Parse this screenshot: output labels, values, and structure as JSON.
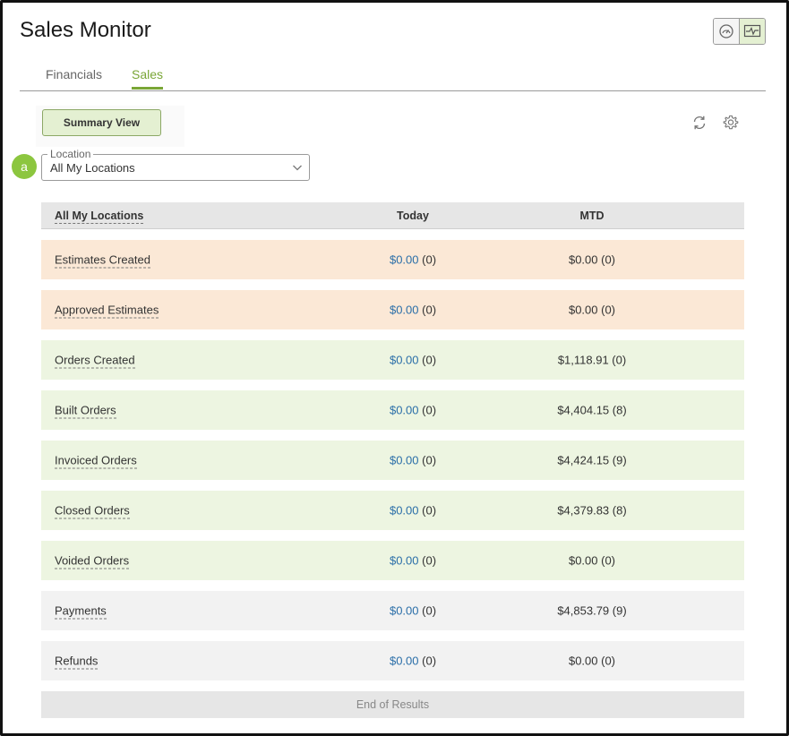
{
  "header": {
    "title": "Sales Monitor",
    "view_toggle": [
      {
        "icon": "gauge-icon",
        "active": false
      },
      {
        "icon": "activity-monitor-icon",
        "active": true
      }
    ]
  },
  "tabs": [
    {
      "label": "Financials",
      "active": false
    },
    {
      "label": "Sales",
      "active": true
    }
  ],
  "toolbar": {
    "summary_view_label": "Summary View",
    "refresh_icon": "refresh-icon",
    "settings_icon": "gear-icon"
  },
  "step_badge": "a",
  "location": {
    "legend": "Location",
    "value": "All My Locations"
  },
  "table": {
    "headers": [
      "All My Locations",
      "Today",
      "MTD"
    ],
    "rows": [
      {
        "label": "Estimates Created",
        "today_amount": "$0.00",
        "today_count": "(0)",
        "mtd": "$0.00 (0)",
        "tone": "peach"
      },
      {
        "label": "Approved Estimates",
        "today_amount": "$0.00",
        "today_count": "(0)",
        "mtd": "$0.00 (0)",
        "tone": "peach"
      },
      {
        "label": "Orders Created",
        "today_amount": "$0.00",
        "today_count": "(0)",
        "mtd": "$1,118.91 (0)",
        "tone": "green"
      },
      {
        "label": "Built Orders",
        "today_amount": "$0.00",
        "today_count": "(0)",
        "mtd": "$4,404.15 (8)",
        "tone": "green"
      },
      {
        "label": "Invoiced Orders",
        "today_amount": "$0.00",
        "today_count": "(0)",
        "mtd": "$4,424.15 (9)",
        "tone": "green"
      },
      {
        "label": "Closed Orders",
        "today_amount": "$0.00",
        "today_count": "(0)",
        "mtd": "$4,379.83 (8)",
        "tone": "green"
      },
      {
        "label": "Voided Orders",
        "today_amount": "$0.00",
        "today_count": "(0)",
        "mtd": "$0.00 (0)",
        "tone": "green"
      },
      {
        "label": "Payments",
        "today_amount": "$0.00",
        "today_count": "(0)",
        "mtd": "$4,853.79 (9)",
        "tone": "gray"
      },
      {
        "label": "Refunds",
        "today_amount": "$0.00",
        "today_count": "(0)",
        "mtd": "$0.00 (0)",
        "tone": "gray"
      }
    ],
    "footer": "End of Results"
  },
  "colors": {
    "accent_green": "#7aa636",
    "badge_green": "#8cc63f",
    "link_blue": "#2a6ea8",
    "estimate_row": "#fbe8d6",
    "order_row": "#edf5e1",
    "payment_row": "#f2f2f2"
  }
}
